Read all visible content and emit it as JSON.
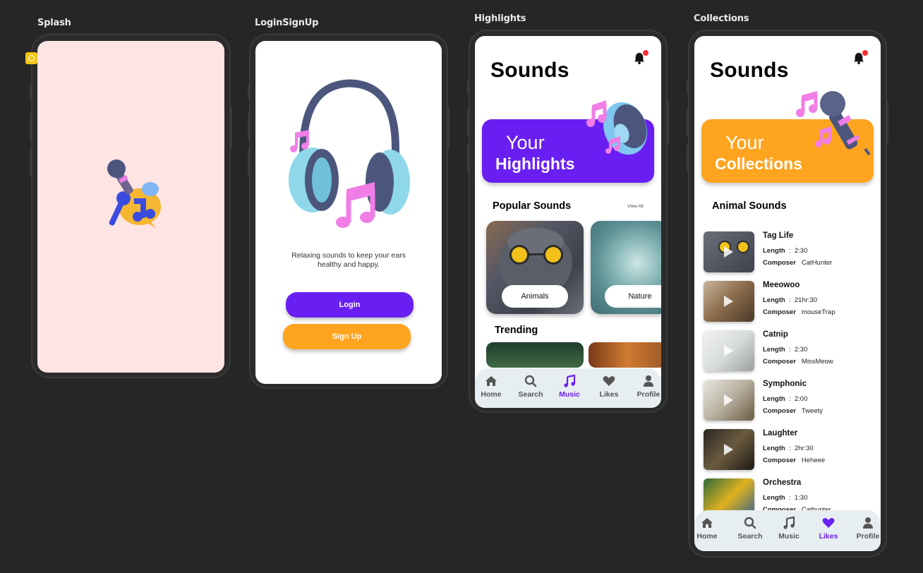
{
  "frames": {
    "splash": {
      "label": "Splash"
    },
    "login": {
      "label": "LoginSignUp"
    },
    "highlights": {
      "label": "Highlights"
    },
    "collections": {
      "label": "Collections"
    }
  },
  "colors": {
    "canvas": "#262626",
    "purple": "#6a1ff2",
    "orange": "#ffa41f",
    "splash_bg": "#ffe4e4",
    "pink_note": "#f07ee6"
  },
  "login": {
    "tagline": "Relaxing sounds to keep your ears healthy and happy.",
    "login_button": "Login",
    "signup_button": "Sign Up"
  },
  "highlights": {
    "title": "Sounds",
    "hero_line1": "Your",
    "hero_line2": "Highlights",
    "popular_title": "Popular Sounds",
    "view_all": "View All",
    "categories": [
      {
        "label": "Animals"
      },
      {
        "label": "Nature"
      }
    ],
    "trending_title": "Trending"
  },
  "collections": {
    "title": "Sounds",
    "hero_line1": "Your",
    "hero_line2": "Collections",
    "section_title": "Animal Sounds",
    "length_label": "Length",
    "composer_label": "Composer",
    "separator": ":",
    "items": [
      {
        "title": "Tag Life",
        "length": "2:30",
        "composer": "CatHunter"
      },
      {
        "title": "Meeowoo",
        "length": "21hr:30",
        "composer": "mouseTrap"
      },
      {
        "title": "Catnip",
        "length": "2:30",
        "composer": "MissMeow"
      },
      {
        "title": "Symphonic",
        "length": "2:00",
        "composer": "Tweety"
      },
      {
        "title": "Laughter",
        "length": "2hr:30",
        "composer": "Heheee"
      },
      {
        "title": "Orchestra",
        "length": "1:30",
        "composer": "Cathunter"
      }
    ]
  },
  "nav": {
    "items": [
      {
        "label": "Home",
        "icon": "home-icon"
      },
      {
        "label": "Search",
        "icon": "search-icon"
      },
      {
        "label": "Music",
        "icon": "music-icon"
      },
      {
        "label": "Likes",
        "icon": "heart-icon"
      },
      {
        "label": "Profile",
        "icon": "profile-icon"
      }
    ],
    "highlights_active": "Music",
    "collections_active": "Likes"
  }
}
